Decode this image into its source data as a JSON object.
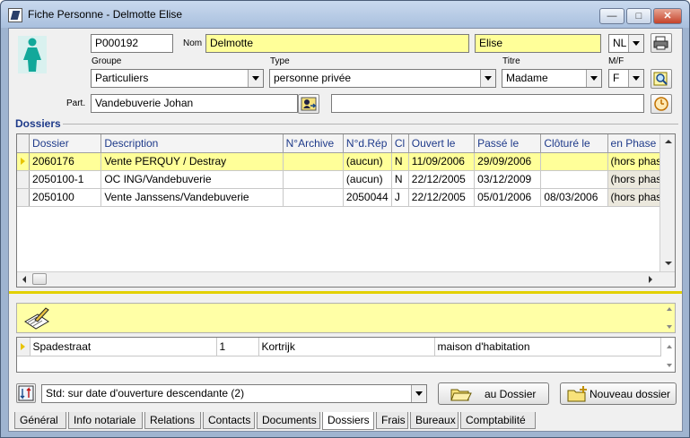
{
  "window": {
    "title": "Fiche Personne - Delmotte Elise",
    "controls": {
      "minimize": "—",
      "maximize": "□",
      "close": "✕"
    }
  },
  "person": {
    "id": "P000192",
    "nom_label": "Nom",
    "nom": "Delmotte",
    "prenom": "Elise",
    "langue": "NL",
    "groupe_label": "Groupe",
    "groupe": "Particuliers",
    "type_label": "Type",
    "type": "personne privée",
    "titre_label": "Titre",
    "titre": "Madame",
    "mf_label": "M/F",
    "mf": "F",
    "part_label": "Part.",
    "partenaire": "Vandebuverie Johan",
    "part_extra": ""
  },
  "dossiers": {
    "section_title": "Dossiers",
    "columns": [
      "Dossier",
      "Description",
      "N°Archive",
      "N°d.Rép",
      "Cl",
      "Ouvert le",
      "Passé le",
      "Clôturé le",
      "en Phase"
    ],
    "rows": [
      {
        "dossier": "2060176",
        "description": "Vente PERQUY / Destray",
        "archive": "",
        "rep": "(aucun)",
        "cl": "N",
        "ouvert": "11/09/2006",
        "passe": "29/09/2006",
        "cloture": "",
        "phase": "(hors phase)"
      },
      {
        "dossier": "2050100-1",
        "description": "OC ING/Vandebuverie",
        "archive": "",
        "rep": "(aucun)",
        "cl": "N",
        "ouvert": "22/12/2005",
        "passe": "03/12/2009",
        "cloture": "",
        "phase": "(hors phase)"
      },
      {
        "dossier": "2050100",
        "description": "Vente Janssens/Vandebuverie",
        "archive": "",
        "rep": "2050044",
        "cl": "J",
        "ouvert": "22/12/2005",
        "passe": "05/01/2006",
        "cloture": "08/03/2006",
        "phase": "(hors phase)"
      }
    ]
  },
  "address": {
    "rue": "Spadestraat",
    "numero": "1",
    "ville": "Kortrijk",
    "nature": "maison d'habitation"
  },
  "sort": {
    "value": "Std: sur date d'ouverture descendante (2)"
  },
  "buttons": {
    "au_dossier": "au Dossier",
    "nouveau_dossier": "Nouveau dossier"
  },
  "tabs": [
    "Général",
    "Info notariale",
    "Relations",
    "Contacts",
    "Documents",
    "Dossiers",
    "Frais",
    "Bureaux",
    "Comptabilité"
  ],
  "active_tab": "Dossiers",
  "icons": {
    "person": "woman-silhouette-icon",
    "print": "printer-icon",
    "search": "magnifier-icon",
    "partner": "partner-link-icon",
    "clock": "clock-icon",
    "note": "notepad-pen-icon",
    "sort": "sort-icon",
    "folder_open": "folder-open-icon",
    "folder_new": "folder-new-icon"
  },
  "colors": {
    "highlight": "#ffff99",
    "accent_blue": "#1e3a8a"
  }
}
